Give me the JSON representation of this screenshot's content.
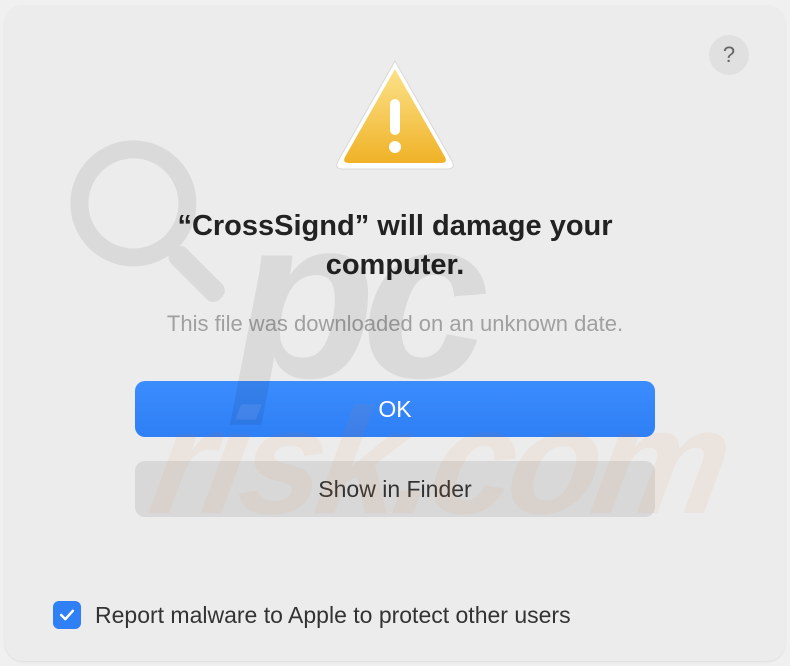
{
  "dialog": {
    "title": "“CrossSignd” will damage your computer.",
    "subtitle": "This file was downloaded on an unknown date.",
    "primary_button": "OK",
    "secondary_button": "Show in Finder",
    "checkbox_label": "Report malware to Apple to protect other users",
    "checkbox_checked": true,
    "help_label": "?"
  },
  "colors": {
    "primary": "#2f7ff5",
    "warning": "#f1b828"
  },
  "watermark": {
    "text1": "pc",
    "text2": "risk.com"
  }
}
